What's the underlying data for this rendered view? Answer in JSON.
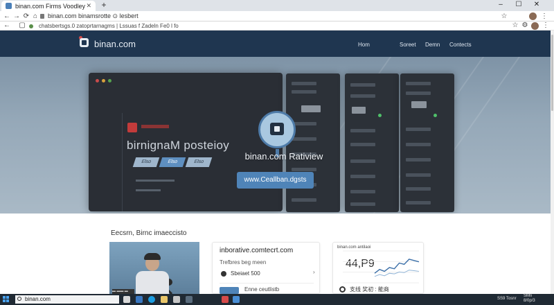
{
  "browser": {
    "tab_title": "binan.com Firms Voodley",
    "tab_close": "✕",
    "new_tab": "+",
    "window_controls": [
      "–",
      "☐",
      "✕"
    ],
    "nav": [
      "←",
      "→",
      "⟳",
      "⌂"
    ],
    "address": "binan.com binamsrotte ⊙ lesbert",
    "bookmarks_text": "chatsbertsgs.0 zatoprtarnagms | Lssuas  f Zadeln  Fe0 l fo",
    "toolbar_icons": [
      "☆",
      "⋮"
    ]
  },
  "site": {
    "brand": "binan.com",
    "nav": [
      "Hom",
      "Soreet",
      "Demn",
      "Contects"
    ],
    "hero": {
      "panel_title": "birnignaM posteioy",
      "panel_buttons": [
        "Elso",
        "Elso",
        "Elso"
      ],
      "heading": "binan.com   Ratiview",
      "cta": "www.Ceallban.dgsts"
    },
    "section_title": "Eecsrn, Birnc imaeccisto",
    "photo_chip": "▬ ▬▬ ▬",
    "card_mid": {
      "title": "inborative.comtecrt.com",
      "line1": "Trefbres beg meen",
      "line2": "Sbeiaet 500",
      "chevron": "›",
      "line3": "Enne  ceutlistb"
    },
    "card_right": {
      "label": "binan.com antilaoi",
      "value": "44,P9",
      "footer": "支线 奖初 : 能商"
    }
  },
  "chart_data": {
    "type": "line",
    "title": "",
    "series": [
      {
        "values": [
          30,
          42,
          36,
          48,
          44,
          62,
          58,
          74,
          70,
          66
        ]
      },
      {
        "values": [
          20,
          26,
          22,
          30,
          28,
          34,
          32,
          40,
          38,
          36
        ]
      }
    ],
    "ylim": [
      0,
      100
    ],
    "colors": [
      "#3b6fa8",
      "#8fb3d6"
    ]
  },
  "taskbar": {
    "search": "binan.com",
    "tray": "SS9 Tosnr",
    "clock": "SMIi\n8/0p/3"
  }
}
